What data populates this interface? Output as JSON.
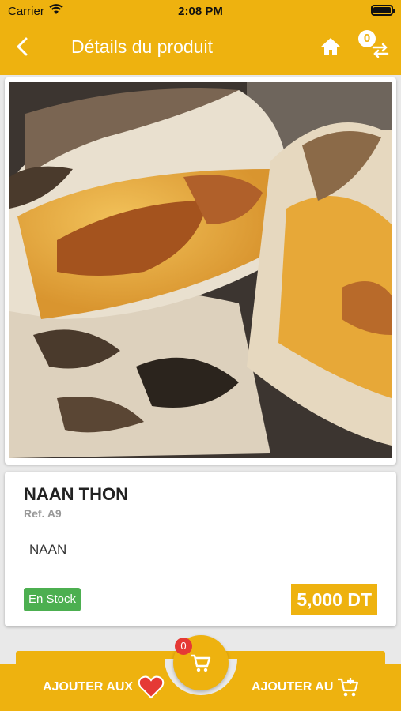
{
  "status_bar": {
    "carrier": "Carrier",
    "time": "2:08 PM"
  },
  "header": {
    "title": "Détails du produit",
    "compare_count": "0"
  },
  "product": {
    "name": "NAAN THON",
    "ref": "Ref. A9",
    "category": "NAAN",
    "stock": "En Stock",
    "price": "5,000 DT",
    "image": "naan-sandwich-photo"
  },
  "actions": {
    "add_to_favorites": "AJOUTER AUX",
    "add_to_cart": "AJOUTER AU",
    "cart_count": "0"
  },
  "colors": {
    "accent": "#eeb20f",
    "stock": "#4caf50",
    "badge": "#e53935",
    "heart": "#e53935"
  }
}
